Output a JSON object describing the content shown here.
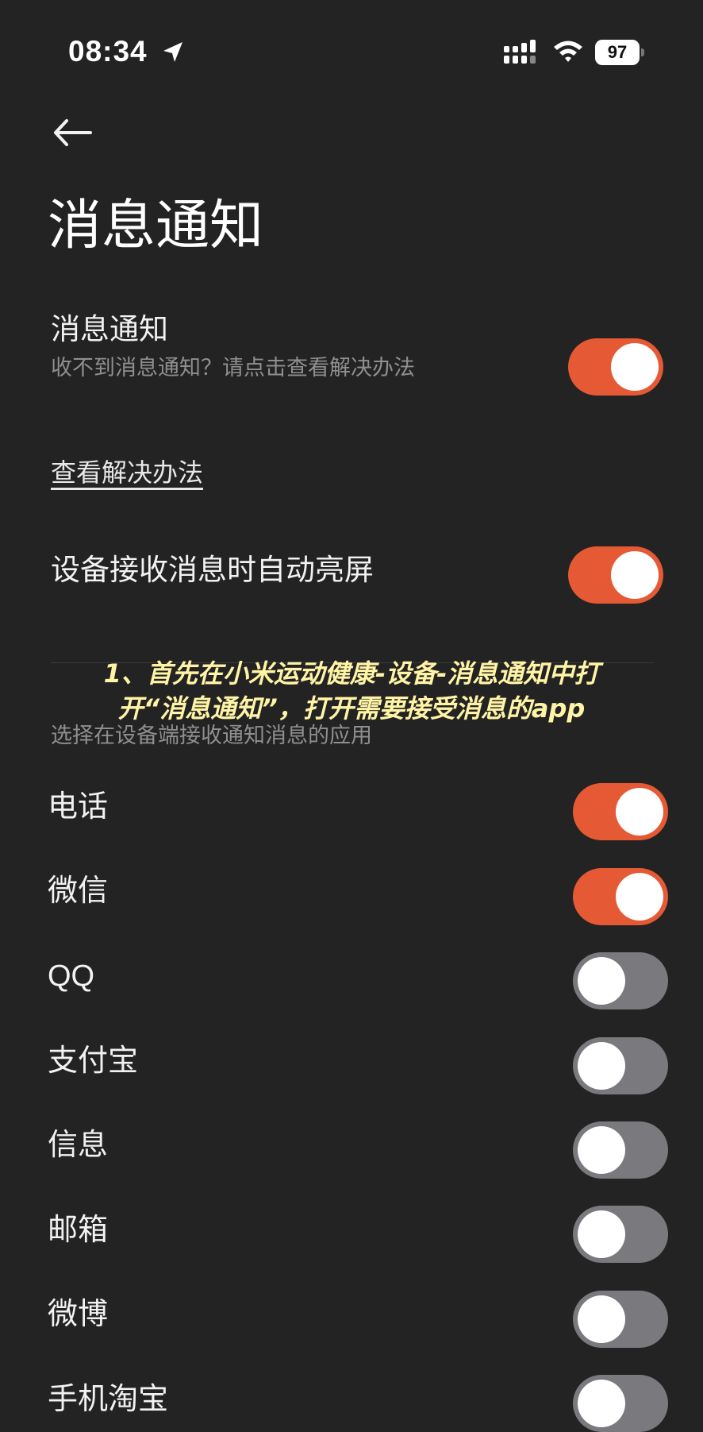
{
  "status_bar": {
    "time": "08:34",
    "battery": "97",
    "icons": [
      "location-arrow-icon",
      "signal-icon",
      "wifi-icon",
      "battery-icon"
    ]
  },
  "header": {
    "back_icon": "back-arrow-icon",
    "title": "消息通知"
  },
  "settings": {
    "notification": {
      "title": "消息通知",
      "subtitle": "收不到消息通知？请点击查看解决办法",
      "enabled": true
    },
    "solution_link": "查看解决办法",
    "auto_wake": {
      "title": "设备接收消息时自动亮屏",
      "enabled": true
    }
  },
  "annotation": {
    "line1": "1、首先在小米运动健康-设备-消息通知中打",
    "line2": "开“消息通知”，打开需要接受消息的app"
  },
  "apps_section": {
    "caption": "选择在设备端接收通知消息的应用",
    "apps": [
      {
        "label": "电话",
        "enabled": true
      },
      {
        "label": "微信",
        "enabled": true
      },
      {
        "label": "QQ",
        "enabled": false
      },
      {
        "label": "支付宝",
        "enabled": false
      },
      {
        "label": "信息",
        "enabled": false
      },
      {
        "label": "邮箱",
        "enabled": false
      },
      {
        "label": "微博",
        "enabled": false
      },
      {
        "label": "手机淘宝",
        "enabled": false
      }
    ]
  },
  "colors": {
    "background": "#232323",
    "toggle_on": "#e55a34",
    "toggle_off": "#7a7a7e",
    "annotation": "#fff4a6"
  }
}
